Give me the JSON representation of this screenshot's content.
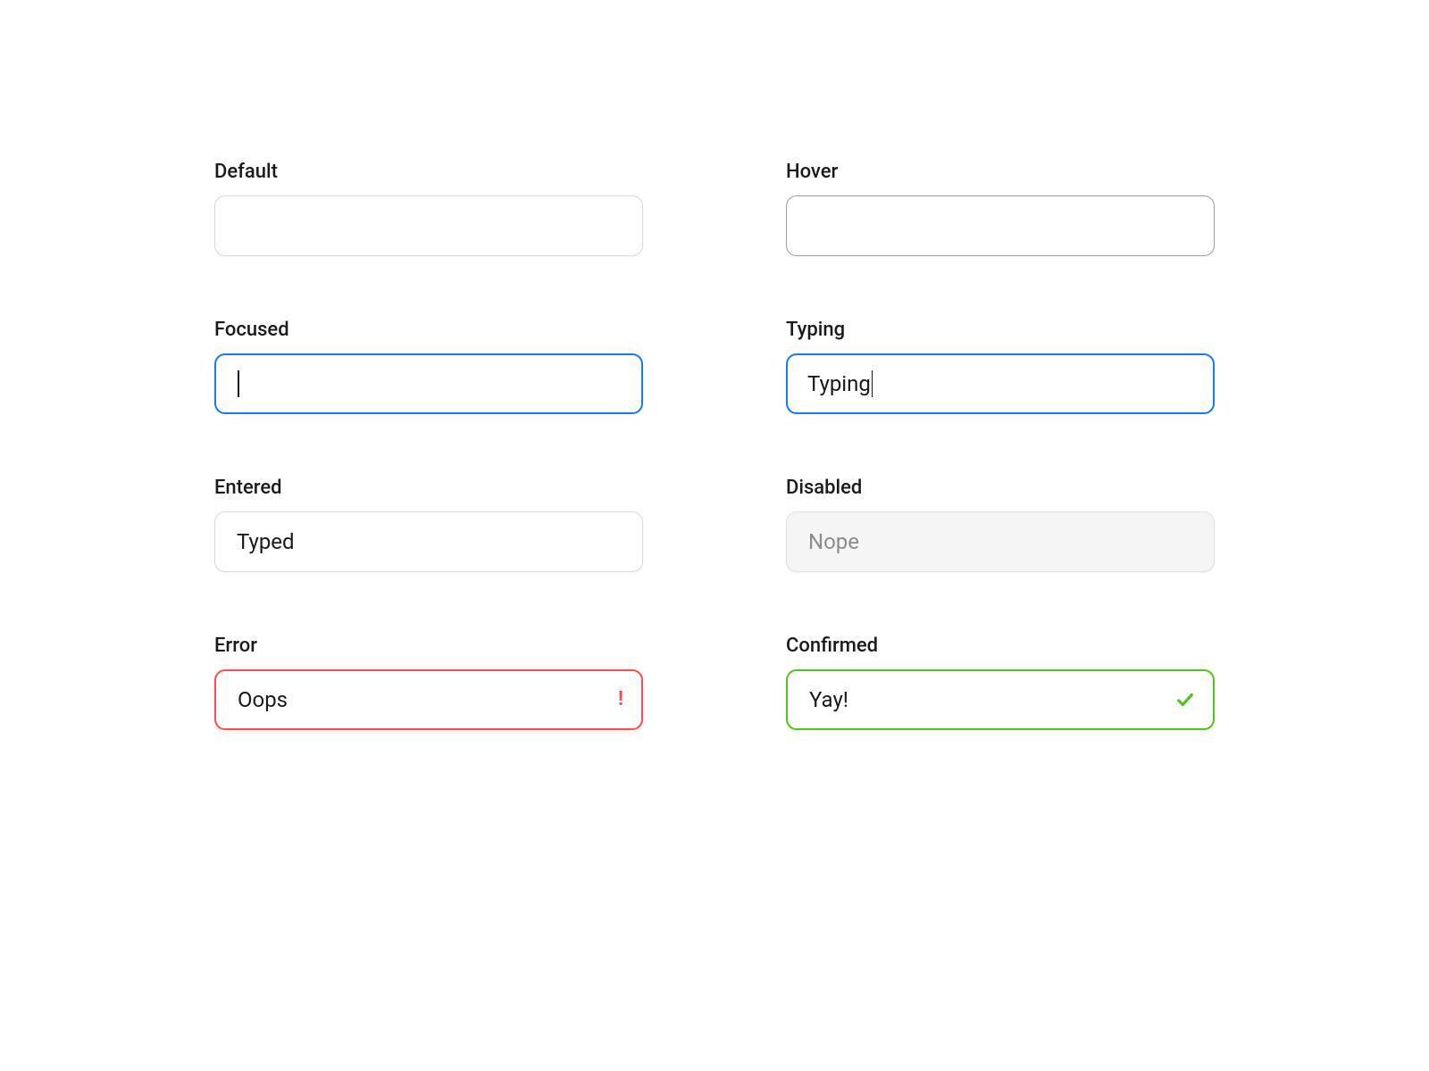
{
  "fields": {
    "default": {
      "label": "Default",
      "value": ""
    },
    "hover": {
      "label": "Hover",
      "value": ""
    },
    "focused": {
      "label": "Focused",
      "value": ""
    },
    "typing": {
      "label": "Typing",
      "value": "Typing"
    },
    "entered": {
      "label": "Entered",
      "value": "Typed"
    },
    "disabled": {
      "label": "Disabled",
      "value": "Nope"
    },
    "error": {
      "label": "Error",
      "value": "Oops"
    },
    "confirmed": {
      "label": "Confirmed",
      "value": "Yay!"
    }
  },
  "colors": {
    "focus": "#1677ff",
    "error": "#ff4d4f",
    "success": "#52c41a",
    "border_default": "#d9d9d9",
    "border_hover": "#9e9e9e",
    "disabled_bg": "#f5f5f5",
    "disabled_text": "#8c8c8c"
  }
}
